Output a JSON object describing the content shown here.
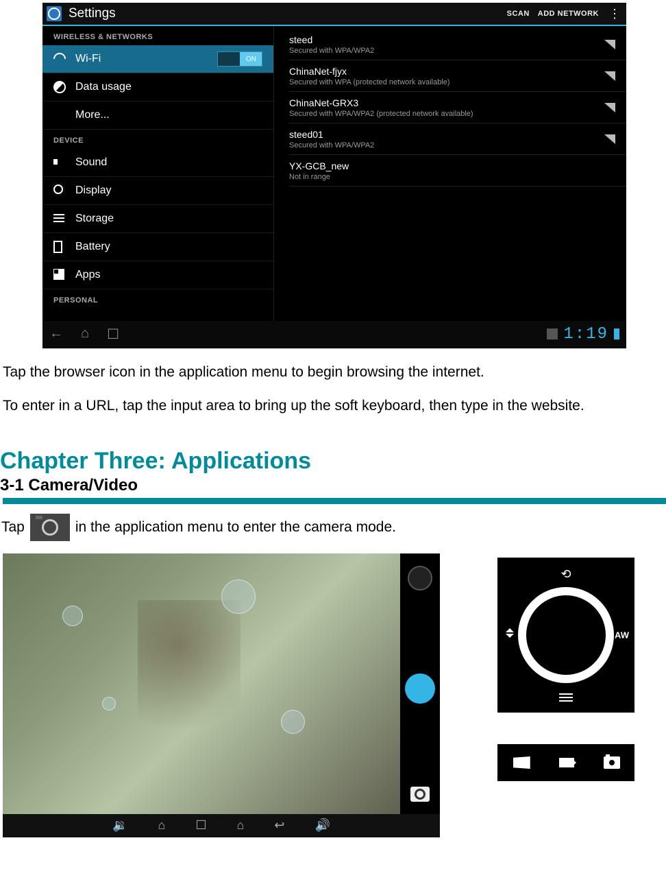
{
  "settings": {
    "title": "Settings",
    "actions": {
      "scan": "SCAN",
      "add": "ADD NETWORK"
    },
    "categories": {
      "wireless": "WIRELESS & NETWORKS",
      "device": "DEVICE",
      "personal": "PERSONAL"
    },
    "menu": {
      "wifi": "Wi-Fi",
      "wifi_toggle": "ON",
      "data": "Data usage",
      "more": "More...",
      "sound": "Sound",
      "display": "Display",
      "storage": "Storage",
      "battery": "Battery",
      "apps": "Apps"
    },
    "networks": [
      {
        "name": "steed",
        "sub": "Secured with WPA/WPA2"
      },
      {
        "name": "ChinaNet-fjyx",
        "sub": "Secured with WPA (protected network available)"
      },
      {
        "name": "ChinaNet-GRX3",
        "sub": "Secured with WPA/WPA2 (protected network available)"
      },
      {
        "name": "steed01",
        "sub": "Secured with WPA/WPA2"
      },
      {
        "name": "YX-GCB_new",
        "sub": "Not in range"
      }
    ],
    "clock": "1:19"
  },
  "body": {
    "p1": "Tap the browser icon in the application menu to begin browsing the internet.",
    "p2": "To enter in a URL, tap the input area to bring up the soft keyboard, then type in the website.",
    "chapter": "Chapter Three: Applications",
    "sub": "3-1 Camera/Video",
    "tap_pre": "Tap",
    "tap_post": " in the application menu to enter the camera mode."
  },
  "camera_dial": {
    "awb": "AW"
  }
}
